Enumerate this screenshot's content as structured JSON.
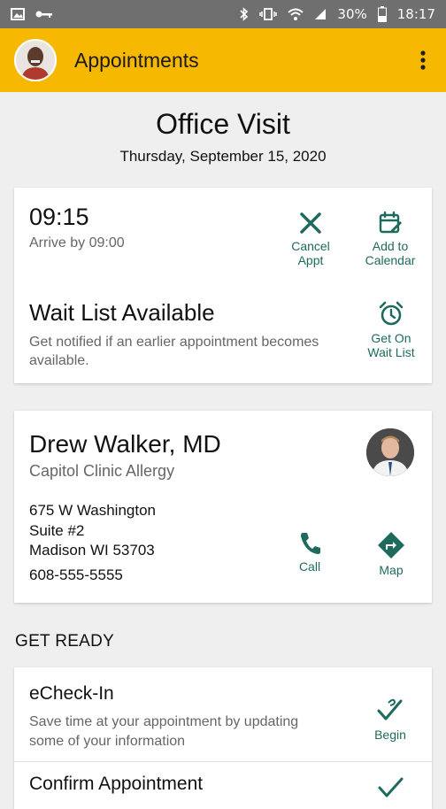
{
  "status_bar": {
    "battery": "30%",
    "time": "18:17"
  },
  "app_bar": {
    "title": "Appointments"
  },
  "page": {
    "title": "Office Visit",
    "date": "Thursday, September 15, 2020"
  },
  "appointment": {
    "time": "09:15",
    "arrive": "Arrive by 09:00",
    "cancel_line1": "Cancel",
    "cancel_line2": "Appt",
    "calendar_line1": "Add to",
    "calendar_line2": "Calendar",
    "waitlist_title": "Wait List Available",
    "waitlist_desc": "Get notified if an earlier appointment becomes available.",
    "waitlist_line1": "Get On",
    "waitlist_line2": "Wait List"
  },
  "provider": {
    "name": "Drew Walker, MD",
    "clinic": "Capitol Clinic Allergy",
    "address_line1": "675 W Washington",
    "address_line2": "Suite #2",
    "address_line3": "Madison WI 53703",
    "phone": "608-555-5555",
    "call_label": "Call",
    "map_label": "Map"
  },
  "get_ready": {
    "heading": "GET READY",
    "echeckin_title": "eCheck-In",
    "echeckin_desc": "Save time at your appointment by updating some of your information",
    "begin_label": "Begin",
    "confirm_title": "Confirm Appointment"
  },
  "colors": {
    "accent": "#1e6b5e",
    "appbar": "#f6b800",
    "statusbar": "#6f6f6f"
  }
}
